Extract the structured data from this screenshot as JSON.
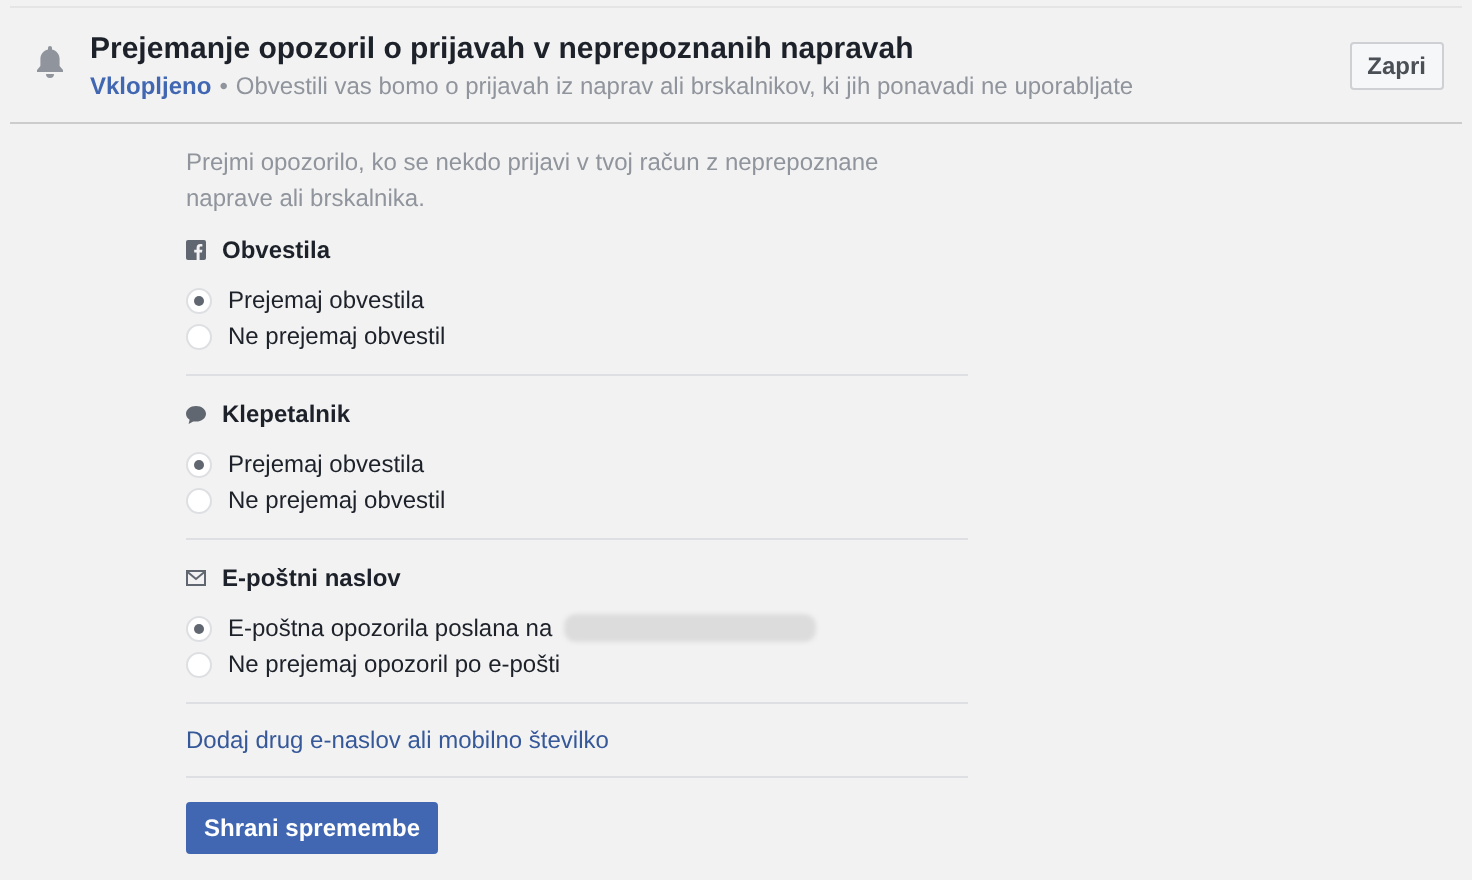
{
  "header": {
    "title": "Prejemanje opozoril o prijavah v neprepoznanih napravah",
    "status": "Vklopljeno",
    "separator": "•",
    "description": "Obvestili vas bomo o prijavah iz naprav ali brskalnikov, ki jih ponavadi ne uporabljate",
    "close_button": "Zapri"
  },
  "intro": "Prejmi opozorilo, ko se nekdo prijavi v tvoj račun z neprepoznane naprave ali brskalnika.",
  "sections": [
    {
      "kind": "facebook",
      "title": "Obvestila",
      "options": [
        {
          "label": "Prejemaj obvestila",
          "selected": true
        },
        {
          "label": "Ne prejemaj obvestil",
          "selected": false
        }
      ]
    },
    {
      "kind": "chat",
      "title": "Klepetalnik",
      "options": [
        {
          "label": "Prejemaj obvestila",
          "selected": true
        },
        {
          "label": "Ne prejemaj obvestil",
          "selected": false
        }
      ]
    },
    {
      "kind": "email",
      "title": "E-poštni naslov",
      "options": [
        {
          "label": "E-poštna opozorila poslana na",
          "selected": true,
          "redacted": true
        },
        {
          "label": "Ne prejemaj opozoril po e-pošti",
          "selected": false
        }
      ]
    }
  ],
  "add_link": "Dodaj drug e-naslov ali mobilno številko",
  "save_button": "Shrani spremembe"
}
